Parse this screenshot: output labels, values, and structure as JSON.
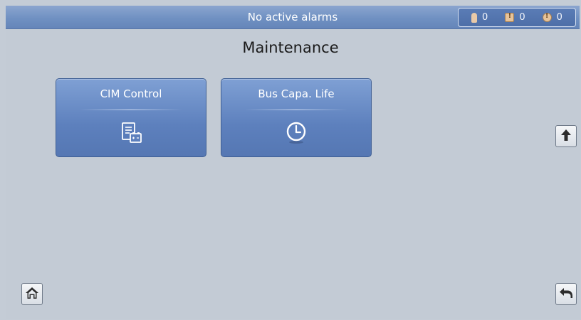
{
  "status_bar": {
    "message": "No active alarms",
    "critical_count": "0",
    "major_count": "0",
    "minor_count": "0"
  },
  "page": {
    "title": "Maintenance"
  },
  "tiles": [
    {
      "label": "CIM Control",
      "icon": "document-battery-icon"
    },
    {
      "label": "Bus Capa. Life",
      "icon": "clock-icon"
    }
  ],
  "nav": {
    "scroll_up": "arrow-up-icon",
    "home": "home-icon",
    "back": "back-arrow-icon"
  },
  "colors": {
    "tile_blue": "#5d80bd",
    "background": "#c3cbd5",
    "topbar_blue": "#7091c2"
  }
}
